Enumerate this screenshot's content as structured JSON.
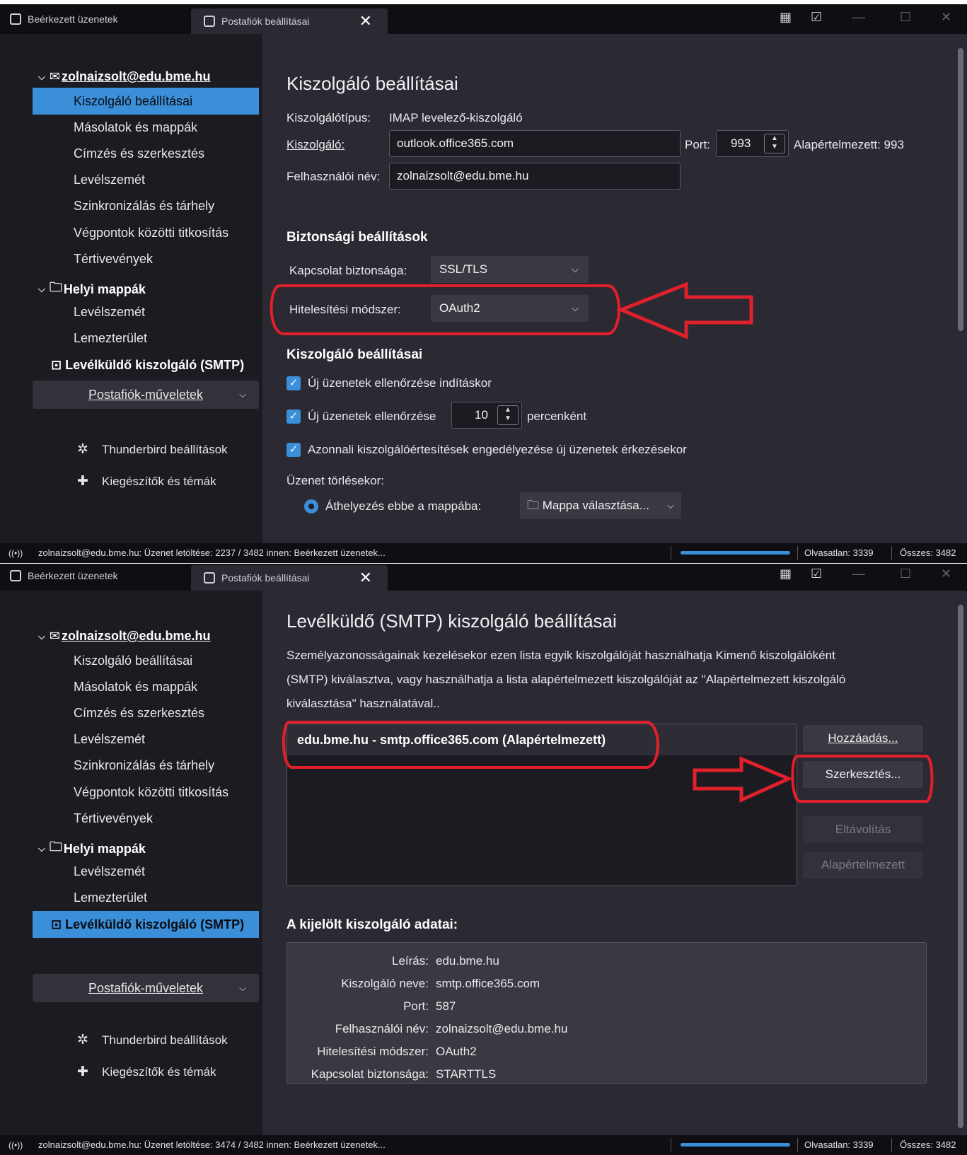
{
  "tabs": {
    "inbox": "Beérkezett üzenetek",
    "settings": "Postafiók beállításai",
    "close": "✕"
  },
  "sidebar": {
    "account": "zolnaizsolt@edu.bme.hu",
    "account_items": [
      "Kiszolgáló beállításai",
      "Másolatok és mappák",
      "Címzés és szerkesztés",
      "Levélszemét",
      "Szinkronizálás és tárhely",
      "Végpontok közötti titkosítás",
      "Tértivevények"
    ],
    "local": "Helyi mappák",
    "local_items": [
      "Levélszemét",
      "Lemezterület"
    ],
    "smtp": "Levélküldő kiszolgáló (SMTP)",
    "account_actions": "Postafiók-műveletek",
    "tb_settings": "Thunderbird beállítások",
    "addons": "Kiegészítők és témák"
  },
  "server_page": {
    "title": "Kiszolgáló beállításai",
    "type_label": "Kiszolgálótípus:",
    "type_value": "IMAP levelező-kiszolgáló",
    "server_label": "Kiszolgáló:",
    "server_value": "outlook.office365.com",
    "port_label": "Port:",
    "port_value": "993",
    "default_port": "Alapértelmezett: 993",
    "user_label": "Felhasználói név:",
    "user_value": "zolnaizsolt@edu.bme.hu",
    "security_heading": "Biztonsági beállítások",
    "conn_label": "Kapcsolat biztonsága:",
    "conn_value": "SSL/TLS",
    "auth_label": "Hitelesítési módszer:",
    "auth_value": "OAuth2",
    "server_heading": "Kiszolgáló beállításai",
    "check1": "Új üzenetek ellenőrzése indításkor",
    "check2": "Új üzenetek ellenőrzése",
    "interval": "10",
    "interval_suffix": "percenként",
    "check3": "Azonnali kiszolgálóértesítések engedélyezése új üzenetek érkezésekor",
    "delete_label": "Üzenet törlésekor:",
    "move_label": "Áthelyezés ebbe a mappába:",
    "folder_button": "Mappa választása..."
  },
  "smtp_page": {
    "title": "Levélküldő (SMTP) kiszolgáló beállításai",
    "desc1": "Személyazonosságainak kezelésekor ezen lista egyik kiszolgálóját használhatja Kimenő kiszolgálóként",
    "desc2": "(SMTP) kiválasztva, vagy használhatja a lista alapértelmezett kiszolgálóját az \"Alapértelmezett kiszolgáló",
    "desc3": "kiválasztása\" használatával..",
    "server_entry": "edu.bme.hu - smtp.office365.com (Alapértelmezett)",
    "add": "Hozzáadás...",
    "edit": "Szerkesztés...",
    "remove": "Eltávolítás",
    "set_default": "Alapértelmezett",
    "details_heading": "A kijelölt kiszolgáló adatai:",
    "details": [
      {
        "k": "Leírás:",
        "v": "edu.bme.hu"
      },
      {
        "k": "Kiszolgáló neve:",
        "v": "smtp.office365.com"
      },
      {
        "k": "Port:",
        "v": "587"
      },
      {
        "k": "Felhasználói név:",
        "v": "zolnaizsolt@edu.bme.hu"
      },
      {
        "k": "Hitelesítési módszer:",
        "v": "OAuth2"
      },
      {
        "k": "Kapcsolat biztonsága:",
        "v": "STARTTLS"
      }
    ]
  },
  "status": {
    "msg1": "zolnaizsolt@edu.bme.hu: Üzenet letöltése: 2237 / 3482 innen: Beérkezett üzenetek...",
    "msg2": "zolnaizsolt@edu.bme.hu: Üzenet letöltése: 3474 / 3482 innen: Beérkezett üzenetek...",
    "unread": "Olvasatlan: 3339",
    "total": "Összes: 3482",
    "progress1": 1.0,
    "progress2": 1.0
  },
  "colors": {
    "accent": "#3a8fd8",
    "annotation": "#e0202a",
    "background": "#1c1b22",
    "content": "#2b2a33"
  }
}
